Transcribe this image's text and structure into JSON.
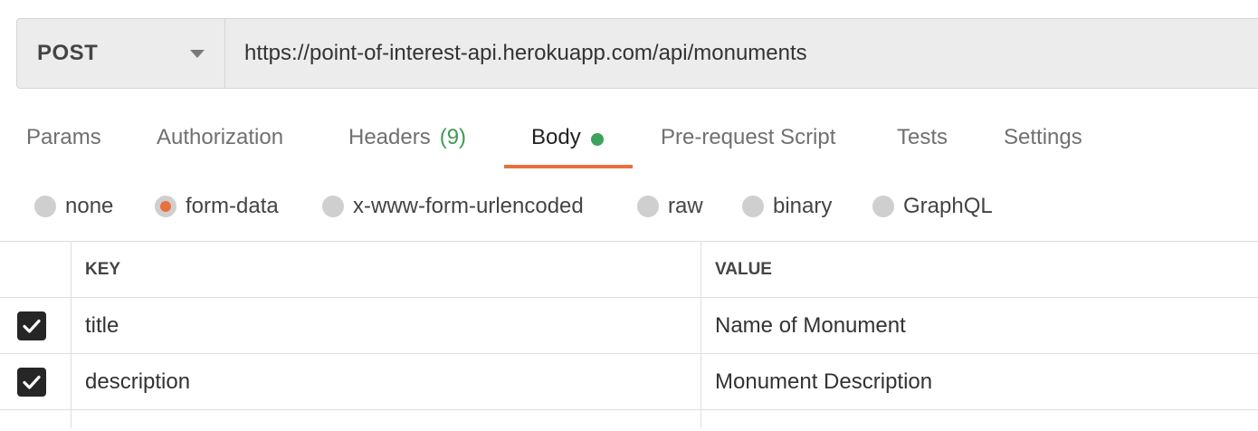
{
  "request": {
    "method": "POST",
    "url": "https://point-of-interest-api.herokuapp.com/api/monuments"
  },
  "tabs": [
    {
      "label": "Params",
      "active": false
    },
    {
      "label": "Authorization",
      "active": false
    },
    {
      "label": "Headers",
      "count": "(9)",
      "active": false
    },
    {
      "label": "Body",
      "active": true
    },
    {
      "label": "Pre-request Script",
      "active": false
    },
    {
      "label": "Tests",
      "active": false
    },
    {
      "label": "Settings",
      "active": false
    }
  ],
  "body_types": [
    {
      "label": "none",
      "checked": false
    },
    {
      "label": "form-data",
      "checked": true
    },
    {
      "label": "x-www-form-urlencoded",
      "checked": false
    },
    {
      "label": "raw",
      "checked": false
    },
    {
      "label": "binary",
      "checked": false
    },
    {
      "label": "GraphQL",
      "checked": false
    }
  ],
  "table": {
    "headers": {
      "key": "KEY",
      "value": "VALUE"
    },
    "rows": [
      {
        "checked": true,
        "key": "title",
        "value": "Name of Monument"
      },
      {
        "checked": true,
        "key": "description",
        "value": "Monument Description"
      }
    ]
  },
  "colors": {
    "accent": "#e8703f",
    "body_dot": "#3da35a",
    "headers_count": "#3e9b52"
  }
}
